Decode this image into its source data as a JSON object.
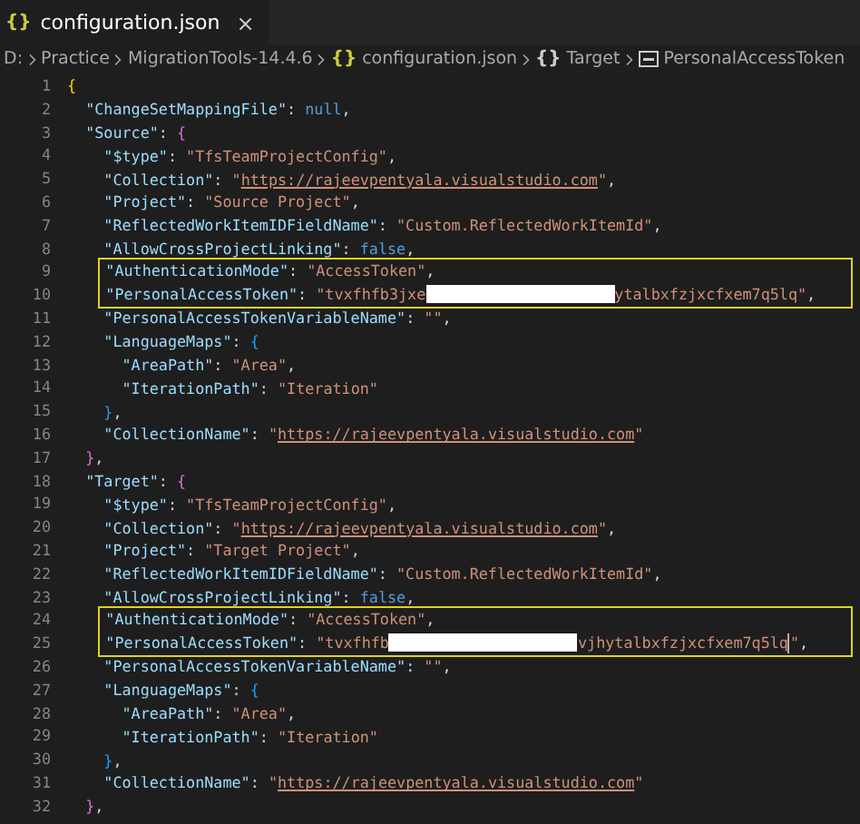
{
  "tab": {
    "icon": "{}",
    "label": "configuration.json",
    "close": "×",
    "selected": true
  },
  "breadcrumb": [
    {
      "kind": "plain",
      "label": "D:"
    },
    {
      "kind": "plain",
      "label": "Practice"
    },
    {
      "kind": "plain",
      "label": "MigrationTools-14.4.6"
    },
    {
      "kind": "file",
      "icon": "{}",
      "label": "configuration.json"
    },
    {
      "kind": "object",
      "icon": "{}",
      "label": "Target"
    },
    {
      "kind": "property",
      "label": "PersonalAccessToken"
    }
  ],
  "lines": [
    {
      "number": "1",
      "highlighted": false,
      "tokens": [
        {
          "kind": "brace1",
          "text": "{"
        }
      ]
    },
    {
      "number": "2",
      "highlighted": false,
      "tokens": [
        {
          "kind": "key",
          "text": "\"ChangeSetMappingFile\""
        },
        {
          "kind": "punct",
          "text": ": "
        },
        {
          "kind": "keyword",
          "text": "null"
        },
        {
          "kind": "punct",
          "text": ","
        }
      ]
    },
    {
      "number": "3",
      "highlighted": false,
      "tokens": [
        {
          "kind": "key",
          "text": "\"Source\""
        },
        {
          "kind": "punct",
          "text": ": "
        },
        {
          "kind": "brace2",
          "text": "{"
        }
      ]
    },
    {
      "number": "4",
      "highlighted": false,
      "tokens": [
        {
          "kind": "key",
          "text": "\"$type\""
        },
        {
          "kind": "punct",
          "text": ": "
        },
        {
          "kind": "string",
          "text": "\"TfsTeamProjectConfig\""
        },
        {
          "kind": "punct",
          "text": ","
        }
      ]
    },
    {
      "number": "5",
      "highlighted": false,
      "tokens": [
        {
          "kind": "key",
          "text": "\"Collection\""
        },
        {
          "kind": "punct",
          "text": ": "
        },
        {
          "kind": "string",
          "text": "\""
        },
        {
          "kind": "link",
          "text": "https://rajeevpentyala.visualstudio.com"
        },
        {
          "kind": "string",
          "text": "\""
        },
        {
          "kind": "punct",
          "text": ","
        }
      ]
    },
    {
      "number": "6",
      "highlighted": false,
      "tokens": [
        {
          "kind": "key",
          "text": "\"Project\""
        },
        {
          "kind": "punct",
          "text": ": "
        },
        {
          "kind": "string",
          "text": "\"Source Project\""
        },
        {
          "kind": "punct",
          "text": ","
        }
      ]
    },
    {
      "number": "7",
      "highlighted": false,
      "tokens": [
        {
          "kind": "key",
          "text": "\"ReflectedWorkItemIDFieldName\""
        },
        {
          "kind": "punct",
          "text": ": "
        },
        {
          "kind": "string",
          "text": "\"Custom.ReflectedWorkItemId\""
        },
        {
          "kind": "punct",
          "text": ","
        }
      ]
    },
    {
      "number": "8",
      "highlighted": false,
      "tokens": [
        {
          "kind": "key",
          "text": "\"AllowCrossProjectLinking\""
        },
        {
          "kind": "punct",
          "text": ": "
        },
        {
          "kind": "keyword",
          "text": "false"
        },
        {
          "kind": "punct",
          "text": ","
        }
      ]
    },
    {
      "number": "9",
      "highlighted": true,
      "tokens": [
        {
          "kind": "key",
          "text": "\"AuthenticationMode\""
        },
        {
          "kind": "punct",
          "text": ": "
        },
        {
          "kind": "string",
          "text": "\"AccessToken\""
        },
        {
          "kind": "punct",
          "text": ","
        }
      ]
    },
    {
      "number": "10",
      "highlighted": true,
      "tokens": [
        {
          "kind": "key",
          "text": "\"PersonalAccessToken\""
        },
        {
          "kind": "punct",
          "text": ": "
        },
        {
          "kind": "string",
          "text": "\"tvxfhfb3jxe"
        },
        {
          "kind": "redaction"
        },
        {
          "kind": "string",
          "text": "ytalbxfzjxcfxem7q5lq\""
        },
        {
          "kind": "punct",
          "text": ","
        }
      ]
    },
    {
      "number": "11",
      "highlighted": false,
      "tokens": [
        {
          "kind": "key",
          "text": "\"PersonalAccessTokenVariableName\""
        },
        {
          "kind": "punct",
          "text": ": "
        },
        {
          "kind": "string",
          "text": "\"\""
        },
        {
          "kind": "punct",
          "text": ","
        }
      ]
    },
    {
      "number": "12",
      "highlighted": false,
      "tokens": [
        {
          "kind": "key",
          "text": "\"LanguageMaps\""
        },
        {
          "kind": "punct",
          "text": ": "
        },
        {
          "kind": "brace3",
          "text": "{"
        }
      ]
    },
    {
      "number": "13",
      "highlighted": false,
      "tokens": [
        {
          "kind": "key",
          "text": "\"AreaPath\""
        },
        {
          "kind": "punct",
          "text": ": "
        },
        {
          "kind": "string",
          "text": "\"Area\""
        },
        {
          "kind": "punct",
          "text": ","
        }
      ]
    },
    {
      "number": "14",
      "highlighted": false,
      "tokens": [
        {
          "kind": "key",
          "text": "\"IterationPath\""
        },
        {
          "kind": "punct",
          "text": ": "
        },
        {
          "kind": "string",
          "text": "\"Iteration\""
        }
      ]
    },
    {
      "number": "15",
      "highlighted": false,
      "tokens": [
        {
          "kind": "brace3",
          "text": "}"
        },
        {
          "kind": "punct",
          "text": ","
        }
      ]
    },
    {
      "number": "16",
      "highlighted": false,
      "tokens": [
        {
          "kind": "key",
          "text": "\"CollectionName\""
        },
        {
          "kind": "punct",
          "text": ": "
        },
        {
          "kind": "string",
          "text": "\""
        },
        {
          "kind": "link",
          "text": "https://rajeevpentyala.visualstudio.com"
        },
        {
          "kind": "string",
          "text": "\""
        }
      ]
    },
    {
      "number": "17",
      "highlighted": false,
      "tokens": [
        {
          "kind": "brace2",
          "text": "}"
        },
        {
          "kind": "punct",
          "text": ","
        }
      ]
    },
    {
      "number": "18",
      "highlighted": false,
      "tokens": [
        {
          "kind": "key",
          "text": "\"Target\""
        },
        {
          "kind": "punct",
          "text": ": "
        },
        {
          "kind": "brace2",
          "text": "{"
        }
      ]
    },
    {
      "number": "19",
      "highlighted": false,
      "tokens": [
        {
          "kind": "key",
          "text": "\"$type\""
        },
        {
          "kind": "punct",
          "text": ": "
        },
        {
          "kind": "string",
          "text": "\"TfsTeamProjectConfig\""
        },
        {
          "kind": "punct",
          "text": ","
        }
      ]
    },
    {
      "number": "20",
      "highlighted": false,
      "tokens": [
        {
          "kind": "key",
          "text": "\"Collection\""
        },
        {
          "kind": "punct",
          "text": ": "
        },
        {
          "kind": "string",
          "text": "\""
        },
        {
          "kind": "link",
          "text": "https://rajeevpentyala.visualstudio.com"
        },
        {
          "kind": "string",
          "text": "\""
        },
        {
          "kind": "punct",
          "text": ","
        }
      ]
    },
    {
      "number": "21",
      "highlighted": false,
      "tokens": [
        {
          "kind": "key",
          "text": "\"Project\""
        },
        {
          "kind": "punct",
          "text": ": "
        },
        {
          "kind": "string",
          "text": "\"Target Project\""
        },
        {
          "kind": "punct",
          "text": ","
        }
      ]
    },
    {
      "number": "22",
      "highlighted": false,
      "tokens": [
        {
          "kind": "key",
          "text": "\"ReflectedWorkItemIDFieldName\""
        },
        {
          "kind": "punct",
          "text": ": "
        },
        {
          "kind": "string",
          "text": "\"Custom.ReflectedWorkItemId\""
        },
        {
          "kind": "punct",
          "text": ","
        }
      ]
    },
    {
      "number": "23",
      "highlighted": false,
      "tokens": [
        {
          "kind": "key",
          "text": "\"AllowCrossProjectLinking\""
        },
        {
          "kind": "punct",
          "text": ": "
        },
        {
          "kind": "keyword",
          "text": "false"
        },
        {
          "kind": "punct",
          "text": ","
        }
      ]
    },
    {
      "number": "24",
      "highlighted": true,
      "tokens": [
        {
          "kind": "key",
          "text": "\"AuthenticationMode\""
        },
        {
          "kind": "punct",
          "text": ": "
        },
        {
          "kind": "string",
          "text": "\"AccessToken\""
        },
        {
          "kind": "punct",
          "text": ","
        }
      ]
    },
    {
      "number": "25",
      "highlighted": true,
      "tokens": [
        {
          "kind": "key",
          "text": "\"PersonalAccessToken\""
        },
        {
          "kind": "punct",
          "text": ": "
        },
        {
          "kind": "string",
          "text": "\"tvxfhfb"
        },
        {
          "kind": "redaction"
        },
        {
          "kind": "string",
          "text": "vjhytalbxfzjxcfxem7q5lq"
        },
        {
          "kind": "cursor"
        },
        {
          "kind": "string",
          "text": "\""
        },
        {
          "kind": "punct",
          "text": ","
        }
      ]
    },
    {
      "number": "26",
      "highlighted": false,
      "tokens": [
        {
          "kind": "key",
          "text": "\"PersonalAccessTokenVariableName\""
        },
        {
          "kind": "punct",
          "text": ": "
        },
        {
          "kind": "string",
          "text": "\"\""
        },
        {
          "kind": "punct",
          "text": ","
        }
      ]
    },
    {
      "number": "27",
      "highlighted": false,
      "tokens": [
        {
          "kind": "key",
          "text": "\"LanguageMaps\""
        },
        {
          "kind": "punct",
          "text": ": "
        },
        {
          "kind": "brace3",
          "text": "{"
        }
      ]
    },
    {
      "number": "28",
      "highlighted": false,
      "tokens": [
        {
          "kind": "key",
          "text": "\"AreaPath\""
        },
        {
          "kind": "punct",
          "text": ": "
        },
        {
          "kind": "string",
          "text": "\"Area\""
        },
        {
          "kind": "punct",
          "text": ","
        }
      ]
    },
    {
      "number": "29",
      "highlighted": false,
      "tokens": [
        {
          "kind": "key",
          "text": "\"IterationPath\""
        },
        {
          "kind": "punct",
          "text": ": "
        },
        {
          "kind": "string",
          "text": "\"Iteration\""
        }
      ]
    },
    {
      "number": "30",
      "highlighted": false,
      "tokens": [
        {
          "kind": "brace3",
          "text": "}"
        },
        {
          "kind": "punct",
          "text": ","
        }
      ]
    },
    {
      "number": "31",
      "highlighted": false,
      "tokens": [
        {
          "kind": "key",
          "text": "\"CollectionName\""
        },
        {
          "kind": "punct",
          "text": ": "
        },
        {
          "kind": "string",
          "text": "\""
        },
        {
          "kind": "link",
          "text": "https://rajeevpentyala.visualstudio.com"
        },
        {
          "kind": "string",
          "text": "\""
        }
      ]
    },
    {
      "number": "32",
      "highlighted": false,
      "tokens": [
        {
          "kind": "brace2",
          "text": "}"
        },
        {
          "kind": "punct",
          "text": ","
        }
      ]
    }
  ]
}
